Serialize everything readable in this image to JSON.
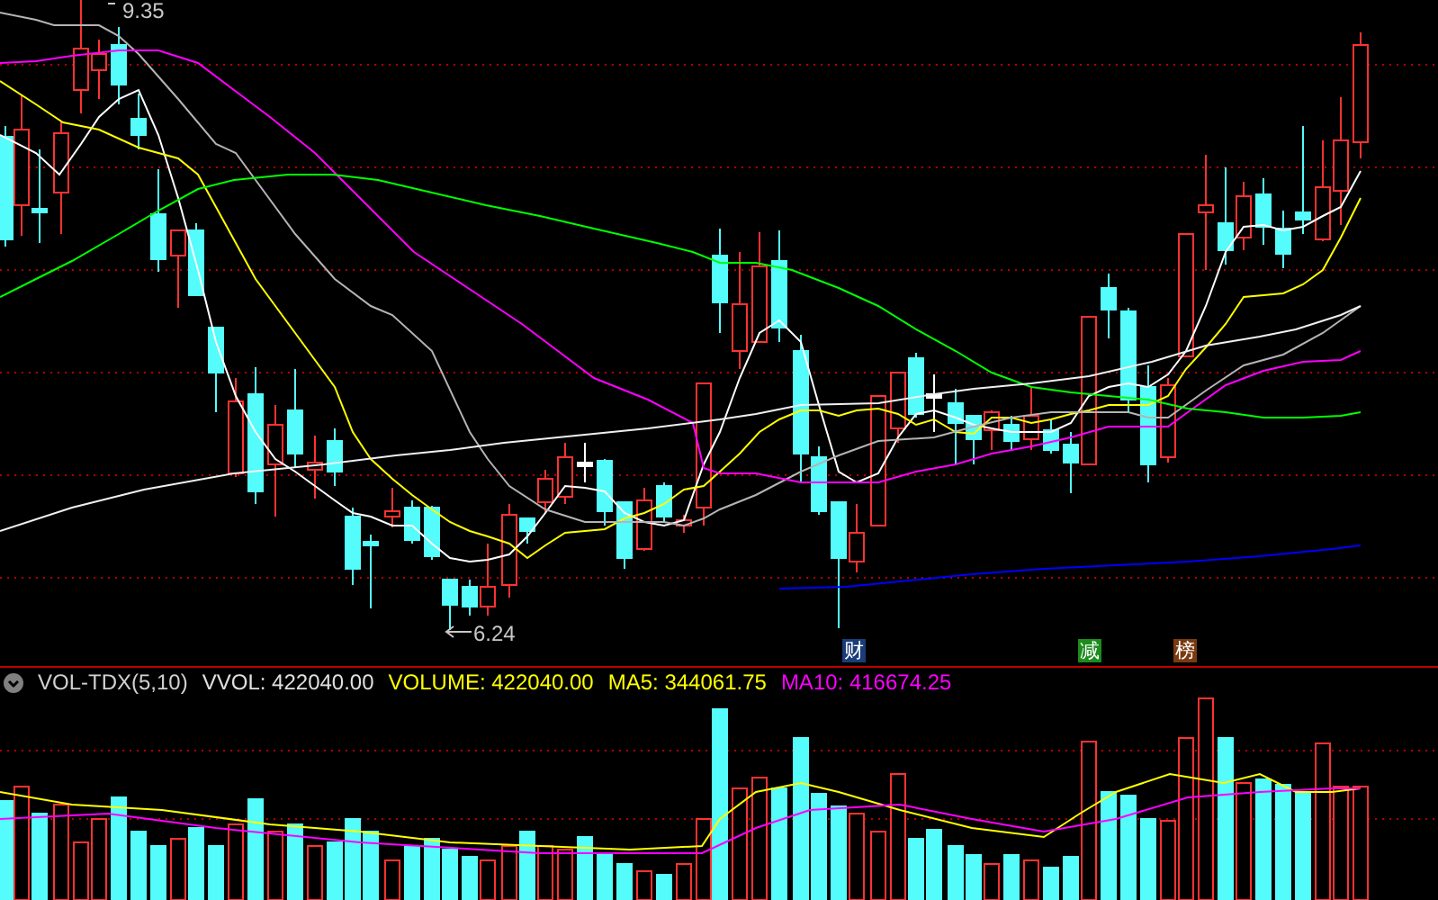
{
  "price_chart": {
    "high_label": "9.35",
    "low_label": "6.24",
    "event_markers": [
      {
        "label": "财",
        "color": "#1a3c78"
      },
      {
        "label": "减",
        "color": "#1c8c1c"
      },
      {
        "label": "榜",
        "color": "#7a3a10"
      }
    ]
  },
  "volume_panel": {
    "indicator": "VOL-TDX(5,10)",
    "legend": [
      {
        "text": "VVOL: 422040.00",
        "color": "#e0e0e0"
      },
      {
        "text": "VOLUME: 422040.00",
        "color": "#ffff00"
      },
      {
        "text": "MA5: 344061.75",
        "color": "#ffff00"
      },
      {
        "text": "MA10: 416674.25",
        "color": "#ff00ff"
      }
    ]
  }
}
